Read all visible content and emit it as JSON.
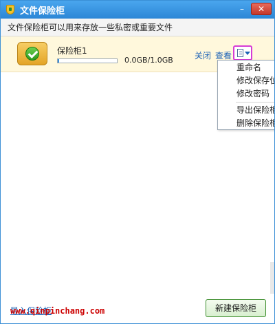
{
  "window": {
    "title": "文件保险柜",
    "minimize_label": "–",
    "close_label": "✕"
  },
  "description": "文件保险柜可以用来存放一些私密或重要文件",
  "vault": {
    "name": "保险柜1",
    "usage_fraction": 0.01,
    "capacity": "0.0GB/1.0GB",
    "close_link": "关闭",
    "view_link": "查看"
  },
  "menu": {
    "items": [
      "重命名",
      "修改保存位置",
      "修改密码",
      "导出保险柜",
      "删除保险柜"
    ]
  },
  "footer": {
    "import_link": "导入保险柜",
    "watermark": "www.qinpinchang.com",
    "new_button": "新建保险柜"
  },
  "colors": {
    "accent": "#2b86d6",
    "link": "#1d62b6",
    "highlight_row": "#fff8dc",
    "menu_button_outline": "#d63bd6"
  }
}
